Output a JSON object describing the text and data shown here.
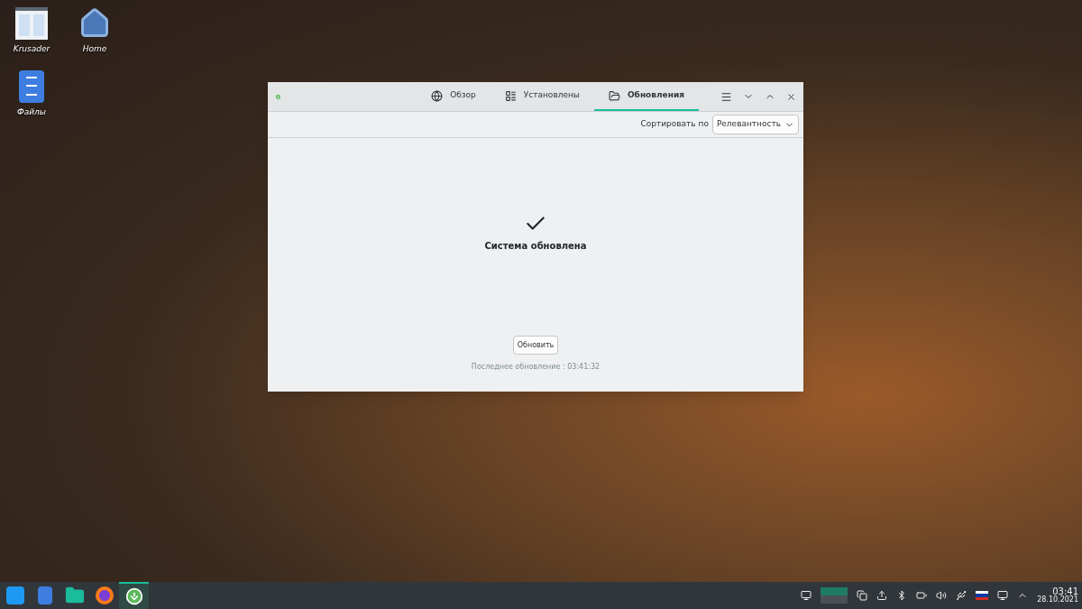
{
  "desktop_icons": [
    {
      "kind": "krusader",
      "label": "Krusader"
    },
    {
      "kind": "home",
      "label": "Home"
    },
    {
      "kind": "files",
      "label": "Файлы"
    }
  ],
  "window": {
    "tabs": [
      {
        "kind": "overview",
        "label": "Обзор",
        "selected": false
      },
      {
        "kind": "installed",
        "label": "Установлены",
        "selected": false
      },
      {
        "kind": "updates",
        "label": "Обновления",
        "selected": true
      }
    ],
    "sort": {
      "label": "Сортировать по",
      "value": "Релевантность"
    },
    "status": {
      "title": "Система обновлена",
      "button": "Обновить",
      "last_update": "Последнее обновление : 03:41:32"
    }
  },
  "taskbar": {
    "apps": [
      {
        "kind": "launcher",
        "active": false
      },
      {
        "kind": "files",
        "active": false
      },
      {
        "kind": "folder",
        "active": false
      },
      {
        "kind": "browser",
        "active": false
      },
      {
        "kind": "discover",
        "active": true
      }
    ],
    "clock": {
      "time": "03:41",
      "date": "28.10.2021"
    }
  }
}
